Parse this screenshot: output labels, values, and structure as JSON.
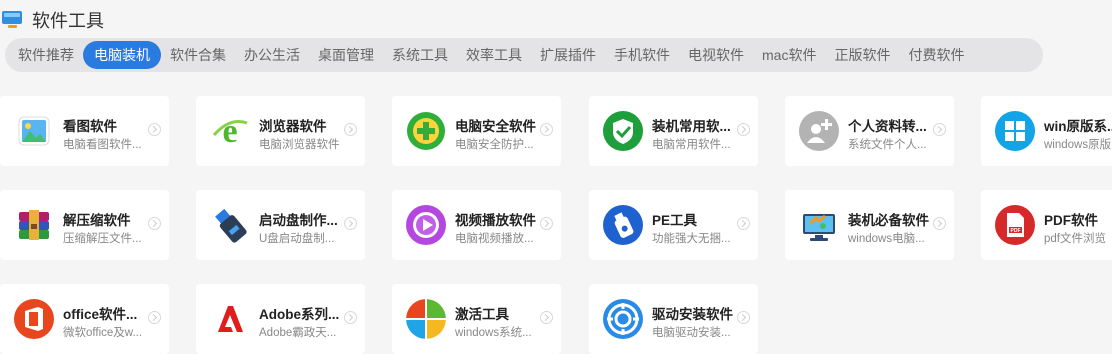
{
  "header": {
    "title": "软件工具",
    "icon": "monitor-icon"
  },
  "tabs": [
    {
      "label": "软件推荐",
      "active": false
    },
    {
      "label": "电脑装机",
      "active": true
    },
    {
      "label": "软件合集",
      "active": false
    },
    {
      "label": "办公生活",
      "active": false
    },
    {
      "label": "桌面管理",
      "active": false
    },
    {
      "label": "系统工具",
      "active": false
    },
    {
      "label": "效率工具",
      "active": false
    },
    {
      "label": "扩展插件",
      "active": false
    },
    {
      "label": "手机软件",
      "active": false
    },
    {
      "label": "电视软件",
      "active": false
    },
    {
      "label": "mac软件",
      "active": false
    },
    {
      "label": "正版软件",
      "active": false
    },
    {
      "label": "付费软件",
      "active": false
    }
  ],
  "cards": [
    {
      "name": "看图软件",
      "desc": "电脑看图软件...",
      "icon": "image-viewer-icon"
    },
    {
      "name": "浏览器软件",
      "desc": "电脑浏览器软件",
      "icon": "browser-icon"
    },
    {
      "name": "电脑安全软件",
      "desc": "电脑安全防护...",
      "icon": "security-plus-icon"
    },
    {
      "name": "装机常用软...",
      "desc": "电脑常用软件...",
      "icon": "shield-check-icon"
    },
    {
      "name": "个人资料转...",
      "desc": "系统文件个人...",
      "icon": "user-add-icon"
    },
    {
      "name": "win原版系...",
      "desc": "windows原版",
      "icon": "windows-logo-icon"
    },
    {
      "name": "解压缩软件",
      "desc": "压缩解压文件...",
      "icon": "archive-books-icon"
    },
    {
      "name": "启动盘制作...",
      "desc": "U盘启动盘制...",
      "icon": "usb-drive-icon"
    },
    {
      "name": "视频播放软件",
      "desc": "电脑视频播放...",
      "icon": "play-icon"
    },
    {
      "name": "PE工具",
      "desc": "功能强大无捆...",
      "icon": "pe-usb-icon"
    },
    {
      "name": "装机必备软件",
      "desc": "windows电脑...",
      "icon": "toolkit-monitor-icon"
    },
    {
      "name": "PDF软件",
      "desc": "pdf文件浏览",
      "icon": "pdf-icon"
    },
    {
      "name": "office软件...",
      "desc": "微软office及w...",
      "icon": "office-logo-icon"
    },
    {
      "name": "Adobe系列...",
      "desc": "Adobe霸政天...",
      "icon": "adobe-logo-icon"
    },
    {
      "name": "激活工具",
      "desc": "windows系统...",
      "icon": "four-color-icon"
    },
    {
      "name": "驱动安装软件",
      "desc": "电脑驱动安装...",
      "icon": "driver-gear-icon"
    }
  ],
  "colors": {
    "accent": "#2a7be0",
    "tab_bar_bg": "#e4e4e6",
    "page_bg": "#f5f5f6"
  }
}
